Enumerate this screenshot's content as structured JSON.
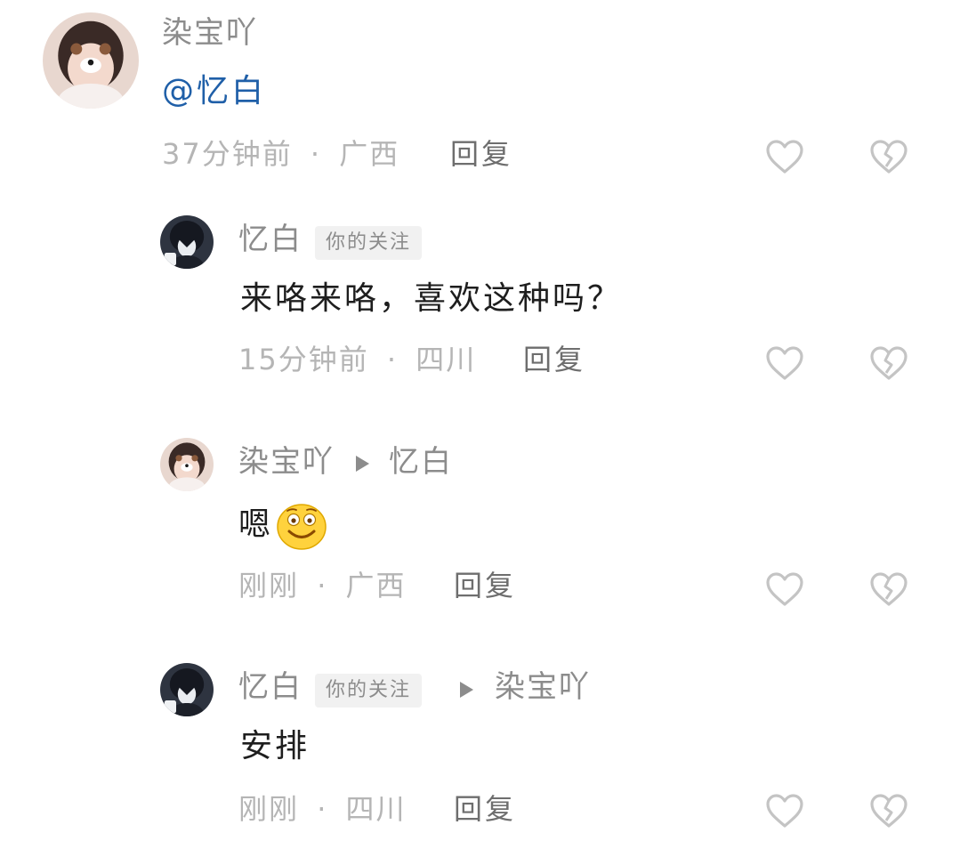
{
  "comments": [
    {
      "author": "染宝吖",
      "text_mention": "@忆白",
      "time": "37分钟前",
      "location": "广西",
      "reply_label": "回复"
    },
    {
      "author": "忆白",
      "badge": "你的关注",
      "text": "来咯来咯，喜欢这种吗？",
      "time": "15分钟前",
      "location": "四川",
      "reply_label": "回复"
    },
    {
      "author": "染宝吖",
      "reply_to": "忆白",
      "text": "嗯",
      "emoji": "smile-emoji",
      "time": "刚刚",
      "location": "广西",
      "reply_label": "回复"
    },
    {
      "author": "忆白",
      "badge": "你的关注",
      "reply_to": "染宝吖",
      "text": "安排",
      "time": "刚刚",
      "location": "四川",
      "reply_label": "回复"
    }
  ],
  "separator": "·",
  "icons": {
    "like": "heart-outline-icon",
    "dislike": "broken-heart-icon"
  },
  "colors": {
    "name": "#8c8c8c",
    "mention": "#1f5fa8",
    "meta": "#b5b5b5",
    "icon": "#c4c4c4"
  }
}
